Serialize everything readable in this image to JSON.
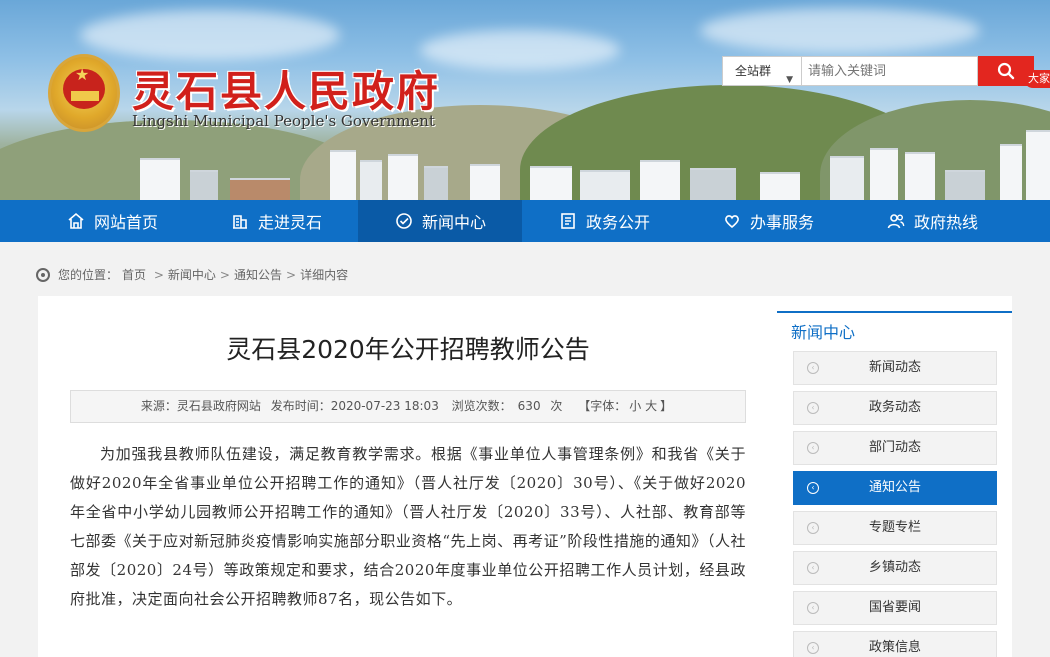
{
  "header": {
    "title": "灵石县人民政府",
    "subtitle": "Lingshi Municipal People's Government",
    "search_scope": "全站群",
    "search_placeholder": "请输入关键词",
    "side_tab": "大家"
  },
  "nav": [
    {
      "label": "网站首页",
      "icon": "home-icon"
    },
    {
      "label": "走进灵石",
      "icon": "building-icon"
    },
    {
      "label": "新闻中心",
      "icon": "check-circle-icon",
      "active": true
    },
    {
      "label": "政务公开",
      "icon": "document-icon"
    },
    {
      "label": "办事服务",
      "icon": "heart-icon"
    },
    {
      "label": "政府热线",
      "icon": "people-icon"
    }
  ],
  "breadcrumb": {
    "prefix": "您的位置：",
    "items": [
      "首页",
      "新闻中心",
      "通知公告",
      "详细内容"
    ]
  },
  "article": {
    "title": "灵石县2020年公开招聘教师公告",
    "source": "来源：灵石县政府网站",
    "publish_time": "发布时间：2020-07-23 18:03",
    "views_label": "浏览次数：",
    "views": "630",
    "views_unit": "次",
    "font_label": "【字体：",
    "font_small": "小",
    "font_large": "大",
    "font_close": "】",
    "body": "为加强我县教师队伍建设，满足教育教学需求。根据《事业单位人事管理条例》和我省《关于做好2020年全省事业单位公开招聘工作的通知》（晋人社厅发〔2020〕30号）、《关于做好2020年全省中小学幼儿园教师公开招聘工作的通知》（晋人社厅发〔2020〕33号）、人社部、教育部等七部委《关于应对新冠肺炎疫情影响实施部分职业资格“先上岗、再考证”阶段性措施的通知》（人社部发〔2020〕24号）等政策规定和要求，结合2020年度事业单位公开招聘工作人员计划，经县政府批准，决定面向社会公开招聘教师87名，现公告如下。"
  },
  "sidebar": {
    "title": "新闻中心",
    "items": [
      {
        "label": "新闻动态"
      },
      {
        "label": "政务动态"
      },
      {
        "label": "部门动态"
      },
      {
        "label": "通知公告",
        "active": true
      },
      {
        "label": "专题专栏"
      },
      {
        "label": "乡镇动态"
      },
      {
        "label": "国省要闻"
      },
      {
        "label": "政策信息"
      }
    ]
  },
  "colors": {
    "nav_blue": "#0f6fc6",
    "title_red": "#d1201b",
    "search_red": "#e3261f"
  }
}
